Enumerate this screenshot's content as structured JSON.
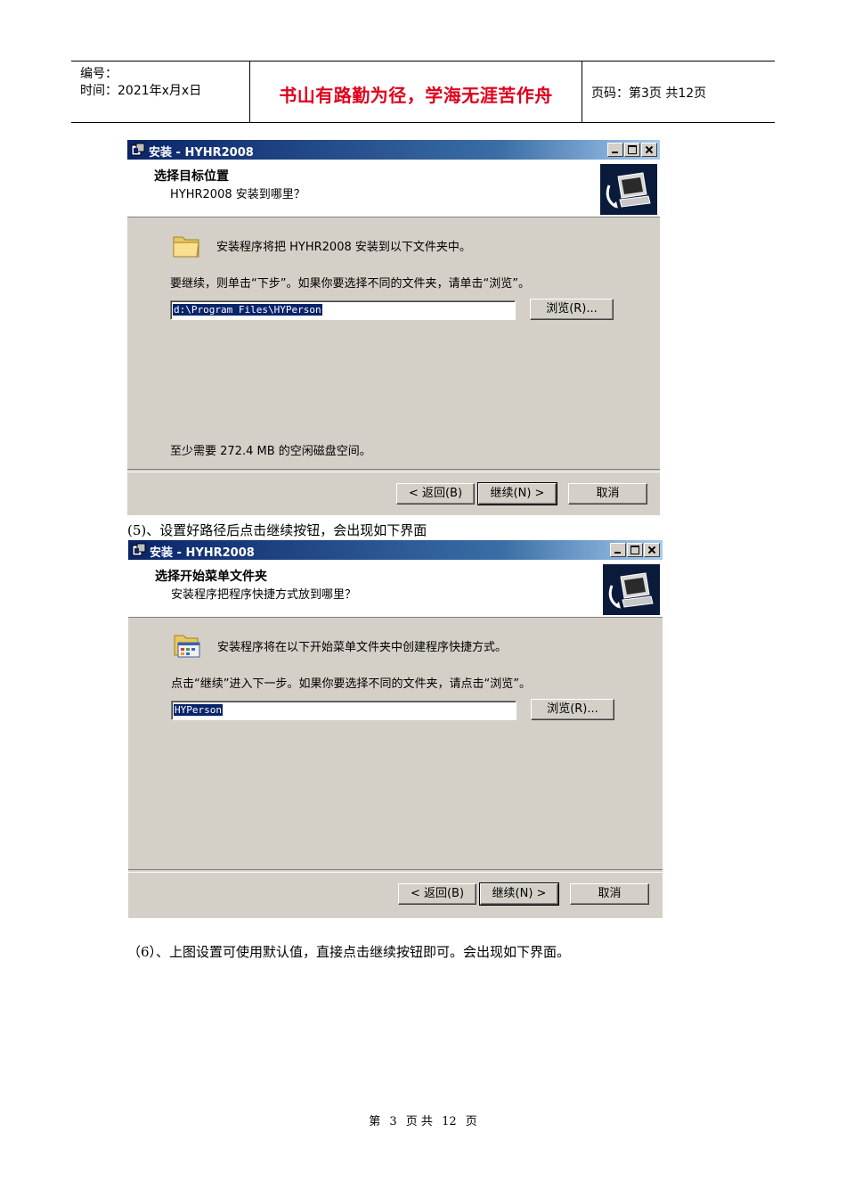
{
  "header": {
    "serial_label": "编号：",
    "date_label": "时间：2021年x月x日",
    "motto": "书山有路勤为径，学海无涯苦作舟",
    "page_info": "页码：第3页  共12页"
  },
  "window1": {
    "title": "安装 - HYHR2008",
    "banner_title": "选择目标位置",
    "banner_subtitle": "HYHR2008 安装到哪里？",
    "intro": "安装程序将把 HYHR2008 安装到以下文件夹中。",
    "instruction": "要继续，则单击“下步”。如果你要选择不同的文件夹，请单击“浏览”。",
    "path_value": "d:\\Program Files\\HYPerson",
    "browse_label": "浏览(R)...",
    "space_text": "至少需要 272.4 MB 的空闲磁盘空间。",
    "back_label": "< 返回(B)",
    "next_label": "继续(N) >",
    "cancel_label": "取消"
  },
  "caption1": "(5)、设置好路径后点击继续按钮，会出现如下界面",
  "window2": {
    "title": "安装 - HYHR2008",
    "banner_title": "选择开始菜单文件夹",
    "banner_subtitle": "安装程序把程序快捷方式放到哪里？",
    "intro": "安装程序将在以下开始菜单文件夹中创建程序快捷方式。",
    "instruction": "点击“继续”进入下一步。如果你要选择不同的文件夹，请点击“浏览”。",
    "path_value": "HYPerson",
    "browse_label": "浏览(R)...",
    "back_label": "< 返回(B)",
    "next_label": "继续(N) >",
    "cancel_label": "取消"
  },
  "caption2": "（6）、上图设置可使用默认值，直接点击继续按钮即可。会出现如下界面。",
  "footer": {
    "page_prefix": "第",
    "page_num": "3",
    "page_mid": "页 共",
    "total": "12",
    "page_suffix": "页"
  }
}
